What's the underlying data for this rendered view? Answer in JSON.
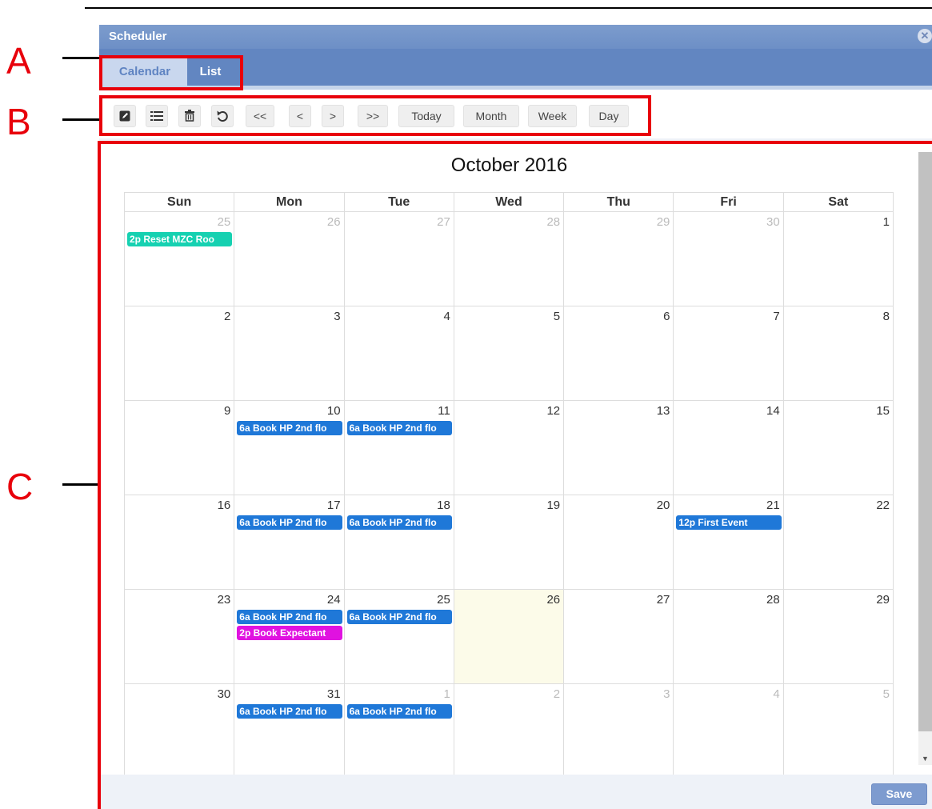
{
  "annotations": {
    "a": "A",
    "b": "B",
    "c": "C"
  },
  "window": {
    "title": "Scheduler",
    "close_icon": "close-icon"
  },
  "tabs": [
    {
      "label": "Calendar"
    },
    {
      "label": "List"
    }
  ],
  "toolbar": {
    "icons": [
      "edit-icon",
      "list-icon",
      "trash-icon",
      "undo-icon"
    ],
    "buttons": [
      "<<",
      "<",
      ">",
      ">>",
      "Today",
      "Month",
      "Week",
      "Day"
    ]
  },
  "calendar": {
    "title": "October 2016",
    "weekdays": [
      "Sun",
      "Mon",
      "Tue",
      "Wed",
      "Thu",
      "Fri",
      "Sat"
    ],
    "weeks": [
      [
        {
          "day": "25",
          "other": true,
          "events": [
            {
              "text": "2p Reset MZC Roo",
              "color": "#16d1b1"
            }
          ]
        },
        {
          "day": "26",
          "other": true,
          "events": []
        },
        {
          "day": "27",
          "other": true,
          "events": []
        },
        {
          "day": "28",
          "other": true,
          "events": []
        },
        {
          "day": "29",
          "other": true,
          "events": []
        },
        {
          "day": "30",
          "other": true,
          "events": []
        },
        {
          "day": "1",
          "other": false,
          "events": []
        }
      ],
      [
        {
          "day": "2",
          "events": []
        },
        {
          "day": "3",
          "events": []
        },
        {
          "day": "4",
          "events": []
        },
        {
          "day": "5",
          "events": []
        },
        {
          "day": "6",
          "events": []
        },
        {
          "day": "7",
          "events": []
        },
        {
          "day": "8",
          "events": []
        }
      ],
      [
        {
          "day": "9",
          "events": []
        },
        {
          "day": "10",
          "events": [
            {
              "text": "6a Book HP 2nd flo",
              "color": "#1f78d8"
            }
          ]
        },
        {
          "day": "11",
          "events": [
            {
              "text": "6a Book HP 2nd flo",
              "color": "#1f78d8"
            }
          ]
        },
        {
          "day": "12",
          "events": []
        },
        {
          "day": "13",
          "events": []
        },
        {
          "day": "14",
          "events": []
        },
        {
          "day": "15",
          "events": []
        }
      ],
      [
        {
          "day": "16",
          "events": []
        },
        {
          "day": "17",
          "events": [
            {
              "text": "6a Book HP 2nd flo",
              "color": "#1f78d8"
            }
          ]
        },
        {
          "day": "18",
          "events": [
            {
              "text": "6a Book HP 2nd flo",
              "color": "#1f78d8"
            }
          ]
        },
        {
          "day": "19",
          "events": []
        },
        {
          "day": "20",
          "events": []
        },
        {
          "day": "21",
          "events": [
            {
              "text": "12p First Event",
              "color": "#1f78d8"
            }
          ]
        },
        {
          "day": "22",
          "events": []
        }
      ],
      [
        {
          "day": "23",
          "events": []
        },
        {
          "day": "24",
          "events": [
            {
              "text": "6a Book HP 2nd flo",
              "color": "#1f78d8"
            },
            {
              "text": "2p Book Expectant",
              "color": "#e012e0"
            }
          ]
        },
        {
          "day": "25",
          "events": [
            {
              "text": "6a Book HP 2nd flo",
              "color": "#1f78d8"
            }
          ]
        },
        {
          "day": "26",
          "today": true,
          "events": []
        },
        {
          "day": "27",
          "events": []
        },
        {
          "day": "28",
          "events": []
        },
        {
          "day": "29",
          "events": []
        }
      ],
      [
        {
          "day": "30",
          "events": []
        },
        {
          "day": "31",
          "events": [
            {
              "text": "6a Book HP 2nd flo",
              "color": "#1f78d8"
            }
          ]
        },
        {
          "day": "1",
          "other": true,
          "events": [
            {
              "text": "6a Book HP 2nd flo",
              "color": "#1f78d8"
            }
          ]
        },
        {
          "day": "2",
          "other": true,
          "events": []
        },
        {
          "day": "3",
          "other": true,
          "events": []
        },
        {
          "day": "4",
          "other": true,
          "events": []
        },
        {
          "day": "5",
          "other": true,
          "events": []
        }
      ]
    ]
  },
  "footer": {
    "save_label": "Save"
  },
  "colors": {
    "accent": "#e8000b",
    "header": "#6286c1",
    "event_blue": "#1f78d8",
    "event_teal": "#16d1b1",
    "event_magenta": "#e012e0"
  }
}
